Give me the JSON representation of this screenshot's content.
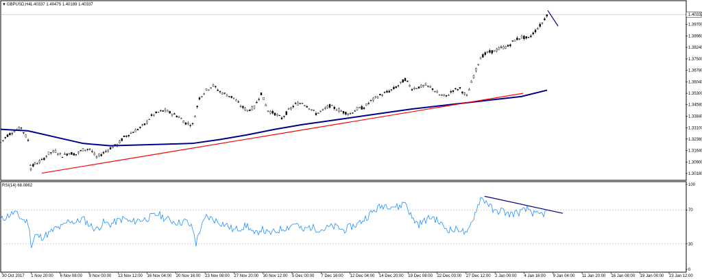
{
  "window": {
    "symbol_title": "GBPUSD,H4",
    "ohlc": "1.40337 1.40475 1.40189 1.40337",
    "indicator_label": "RSI(14) 68.0862"
  },
  "chart_data": [
    {
      "type": "candlestick",
      "title": "GBPUSD,H4",
      "ylim": [
        1.3018,
        1.4052
      ],
      "y_ticks": [
        "1.40337",
        "1.39700",
        "1.38960",
        "1.38240",
        "1.37500",
        "1.36780",
        "1.36040",
        "1.35300",
        "1.34580",
        "1.33840",
        "1.33100",
        "1.32380",
        "1.31640",
        "1.30900",
        "1.30180"
      ],
      "current_price": "1.40337",
      "series": [
        {
          "kind": "price",
          "color": "#000000",
          "x": [
            0,
            10,
            20,
            30,
            40,
            44,
            50,
            60,
            70,
            80,
            90,
            100,
            110,
            120,
            130,
            140,
            150,
            160,
            170,
            180,
            190,
            200,
            210,
            220,
            230,
            240,
            250,
            260,
            270,
            280,
            290,
            300,
            310,
            320,
            330,
            340,
            350,
            360,
            370,
            380,
            390,
            400,
            410,
            420,
            430,
            440,
            450,
            460,
            470,
            480,
            490,
            500,
            510,
            520,
            530,
            540,
            550,
            560,
            570,
            580,
            590,
            600,
            610,
            620,
            630,
            640,
            650,
            660,
            670,
            680,
            690,
            700,
            710,
            720,
            730,
            740,
            750,
            760,
            770,
            780,
            790,
            797
          ],
          "y": [
            1.3215,
            1.3262,
            1.329,
            1.331,
            1.323,
            1.305,
            1.308,
            1.31,
            1.3145,
            1.316,
            1.313,
            1.315,
            1.314,
            1.317,
            1.3175,
            1.312,
            1.315,
            1.318,
            1.32,
            1.325,
            1.3275,
            1.33,
            1.333,
            1.3385,
            1.341,
            1.342,
            1.34,
            1.338,
            1.334,
            1.333,
            1.35,
            1.355,
            1.358,
            1.354,
            1.352,
            1.35,
            1.345,
            1.342,
            1.344,
            1.353,
            1.342,
            1.34,
            1.337,
            1.342,
            1.346,
            1.347,
            1.344,
            1.34,
            1.342,
            1.345,
            1.343,
            1.341,
            1.34,
            1.343,
            1.344,
            1.348,
            1.351,
            1.353,
            1.355,
            1.358,
            1.362,
            1.356,
            1.357,
            1.358,
            1.356,
            1.352,
            1.351,
            1.355,
            1.356,
            1.351,
            1.364,
            1.376,
            1.379,
            1.38,
            1.382,
            1.383,
            1.387,
            1.389,
            1.388,
            1.393,
            1.398,
            1.4035
          ]
        },
        {
          "kind": "moving-average",
          "color": "#00008b",
          "x": [
            0,
            40,
            80,
            120,
            160,
            200,
            240,
            280,
            320,
            360,
            400,
            440,
            480,
            520,
            560,
            600,
            640,
            680,
            720,
            760,
            797
          ],
          "y": [
            1.33,
            1.329,
            1.325,
            1.321,
            1.3195,
            1.32,
            1.3205,
            1.321,
            1.3235,
            1.3265,
            1.33,
            1.333,
            1.3355,
            1.338,
            1.3405,
            1.343,
            1.345,
            1.347,
            1.349,
            1.351,
            1.355
          ]
        },
        {
          "kind": "trendline",
          "color": "#ff0000",
          "x": [
            60,
            762
          ],
          "y": [
            1.302,
            1.353
          ]
        },
        {
          "kind": "trendline",
          "color": "#00008b",
          "x": [
            798,
            813
          ],
          "y": [
            1.406,
            1.396
          ]
        }
      ]
    },
    {
      "type": "line",
      "title": "RSI(14) 68.0862",
      "ylim": [
        0,
        100
      ],
      "y_ticks": [
        "100",
        "70",
        "30",
        "0"
      ],
      "levels": [
        70,
        30
      ],
      "series": [
        {
          "kind": "rsi",
          "color": "#1e90ff",
          "x": [
            0,
            10,
            20,
            30,
            40,
            45,
            50,
            60,
            70,
            80,
            90,
            100,
            110,
            120,
            130,
            140,
            150,
            160,
            170,
            180,
            190,
            200,
            210,
            220,
            230,
            240,
            250,
            260,
            270,
            280,
            285,
            290,
            300,
            310,
            320,
            330,
            340,
            350,
            360,
            370,
            380,
            390,
            400,
            410,
            420,
            430,
            440,
            450,
            460,
            470,
            480,
            490,
            500,
            510,
            520,
            530,
            540,
            550,
            560,
            570,
            580,
            590,
            600,
            610,
            620,
            630,
            640,
            650,
            660,
            670,
            680,
            690,
            700,
            710,
            720,
            730,
            740,
            750,
            760,
            770,
            780,
            790,
            797
          ],
          "y": [
            58,
            63,
            67,
            60,
            55,
            27,
            40,
            38,
            42,
            48,
            50,
            58,
            55,
            60,
            52,
            47,
            55,
            53,
            57,
            60,
            55,
            58,
            59,
            62,
            65,
            60,
            57,
            55,
            57,
            48,
            30,
            45,
            62,
            59,
            55,
            52,
            46,
            49,
            52,
            40,
            48,
            42,
            44,
            48,
            50,
            55,
            45,
            50,
            48,
            47,
            50,
            50,
            46,
            50,
            53,
            59,
            66,
            72,
            76,
            75,
            73,
            80,
            60,
            53,
            58,
            62,
            55,
            48,
            46,
            48,
            40,
            62,
            84,
            79,
            67,
            70,
            65,
            66,
            68,
            71,
            64,
            65,
            67
          ]
        },
        {
          "kind": "trendline",
          "color": "#00008b",
          "x": [
            707,
            821
          ],
          "y": [
            86,
            66
          ]
        }
      ]
    }
  ],
  "x_axis": {
    "labels": [
      "30 Oct 2017",
      "1 Nov 20:00",
      "6 Nov 08:00",
      "9 Nov 00:00",
      "13 Nov 12:00",
      "16 Nov 04:00",
      "20 Nov 16:00",
      "23 Nov 08:00",
      "27 Nov 20:00",
      "30 Nov 12:00",
      "5 Dec 00:00",
      "7 Dec 16:00",
      "12 Dec 04:00",
      "14 Dec 20:00",
      "19 Dec 08:00",
      "22 Dec 00:00",
      "27 Dec 12:00",
      "2 Jan 00:00",
      "4 Jan 16:00",
      "9 Jan 04:00",
      "11 Jan 20:00",
      "16 Jan 08:00",
      "19 Jan 00:00",
      "23 Jan 12:00"
    ]
  }
}
